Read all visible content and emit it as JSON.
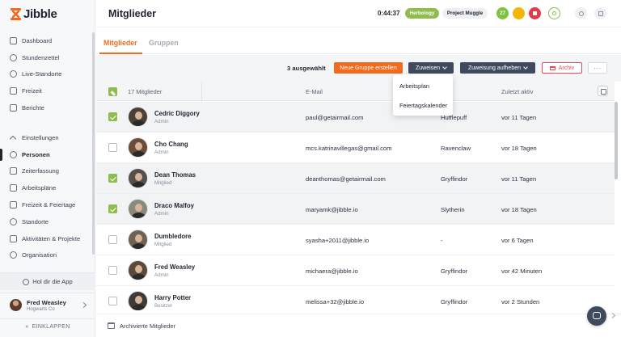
{
  "app": {
    "logo_text": "Jibble"
  },
  "sidebar": {
    "items": [
      {
        "label": "Dashboard",
        "icon": "dashboard-icon"
      },
      {
        "label": "Stundenzettel",
        "icon": "clock-icon"
      },
      {
        "label": "Live-Standorte",
        "icon": "location-pin-icon"
      },
      {
        "label": "Freizeit",
        "icon": "suitcase-icon"
      },
      {
        "label": "Berichte",
        "icon": "report-icon"
      }
    ],
    "section_label": "Einstellungen",
    "settings_items": [
      {
        "label": "Personen",
        "icon": "people-icon",
        "active": true
      },
      {
        "label": "Zeiterfassung",
        "icon": "time-tracking-icon"
      },
      {
        "label": "Arbeitspläne",
        "icon": "schedule-icon"
      },
      {
        "label": "Freizeit & Feiertage",
        "icon": "calendar-icon"
      },
      {
        "label": "Standorte",
        "icon": "location-icon"
      },
      {
        "label": "Aktivitäten & Projekte",
        "icon": "tag-icon"
      },
      {
        "label": "Organisation",
        "icon": "gear-icon"
      }
    ],
    "app_button": "Hol dir die App",
    "user": {
      "name": "Fred Weasley",
      "org": "Hogwarts Co"
    },
    "collapse_label": "EINKLAPPEN"
  },
  "header": {
    "title": "Mitglieder",
    "timer": "0:44:37",
    "activity_chip": "Herbology",
    "project_chip": "Project Muggle",
    "counter_badge": "27"
  },
  "tabs": [
    {
      "label": "Mitglieder",
      "active": true
    },
    {
      "label": "Gruppen",
      "active": false
    }
  ],
  "toolbar": {
    "selected_count": "3 ausgewählt",
    "new_group": "Neue Gruppe erstellen",
    "assign": "Zuweisen",
    "unassign": "Zuweisung aufheben",
    "archive": "Archiv",
    "more": "···"
  },
  "dropdown": {
    "items": [
      "Arbeitsplan",
      "Feiertagskalender"
    ]
  },
  "table": {
    "headers": {
      "name": "17 Mitglieder",
      "email": "E-Mail",
      "group": "ppe",
      "last": "Zuletzt aktiv"
    },
    "rows": [
      {
        "name": "Cedric Diggory",
        "role": "Admin",
        "email": "paul@getairmail.com",
        "group": "Hufflepuff",
        "last": "vor 11 Tagen",
        "checked": true
      },
      {
        "name": "Cho Chang",
        "role": "Admin",
        "email": "mcs.katrinavillegas@gmail.com",
        "group": "Ravenclaw",
        "last": "vor 18 Tagen",
        "checked": false
      },
      {
        "name": "Dean Thomas",
        "role": "Mitglied",
        "email": "deanthomas@getairmail.com",
        "group": "Gryffindor",
        "last": "vor 11 Tagen",
        "checked": true
      },
      {
        "name": "Draco Malfoy",
        "role": "Admin",
        "email": "maryamk@jibble.io",
        "group": "Slytherin",
        "last": "vor 18 Tagen",
        "checked": true
      },
      {
        "name": "Dumbledore",
        "role": "Mitglied",
        "email": "syasha+2011@jibble.io",
        "group": "-",
        "last": "vor 6 Tagen",
        "checked": false
      },
      {
        "name": "Fred Weasley",
        "role": "Admin",
        "email": "michaera@jibble.io",
        "group": "Gryffindor",
        "last": "vor 42 Minuten",
        "checked": false
      },
      {
        "name": "Harry Potter",
        "role": "Besitzer",
        "email": "melissa+32@jibble.io",
        "group": "Gryffindor",
        "last": "vor 2 Stunden",
        "checked": false
      }
    ]
  },
  "footer": {
    "archived_label": "Archivierte Mitglieder"
  },
  "colors": {
    "accent": "#f26b1d",
    "check": "#8fbc4f",
    "dark_button": "#3f4a5e",
    "danger": "#e2495a"
  }
}
